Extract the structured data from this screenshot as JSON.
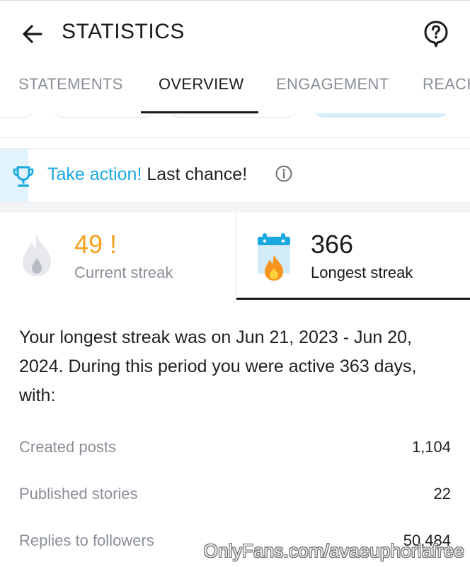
{
  "header": {
    "title": "STATISTICS",
    "back_icon": "arrow-left-icon",
    "help_icon": "help-circle-icon"
  },
  "tabs": [
    {
      "label": "STATEMENTS",
      "active": false
    },
    {
      "label": "OVERVIEW",
      "active": true
    },
    {
      "label": "ENGAGEMENT",
      "active": false
    },
    {
      "label": "REACH",
      "active": false
    }
  ],
  "banner": {
    "icon": "trophy-icon",
    "link_text": "Take action!",
    "text": "Last chance!",
    "info_icon": "info-icon"
  },
  "streaks": {
    "current": {
      "value": "49 !",
      "label": "Current streak",
      "icon": "flame-icon"
    },
    "longest": {
      "value": "366",
      "label": "Longest streak",
      "icon": "calendar-fire-icon",
      "selected": true
    }
  },
  "summary": "Your longest streak was on Jun 21, 2023 - Jun 20, 2024. During this period you were active 363 days, with:",
  "stats": [
    {
      "label": "Created posts",
      "value": "1,104"
    },
    {
      "label": "Published stories",
      "value": "22"
    },
    {
      "label": "Replies to followers",
      "value": "50,484"
    }
  ],
  "watermark": "OnlyFans.com/avaeuphoriafree",
  "colors": {
    "accent_blue": "#1aa8e0",
    "streak_orange": "#f4a11c",
    "muted_text": "#8a8f98",
    "text": "#1f1f1f"
  }
}
